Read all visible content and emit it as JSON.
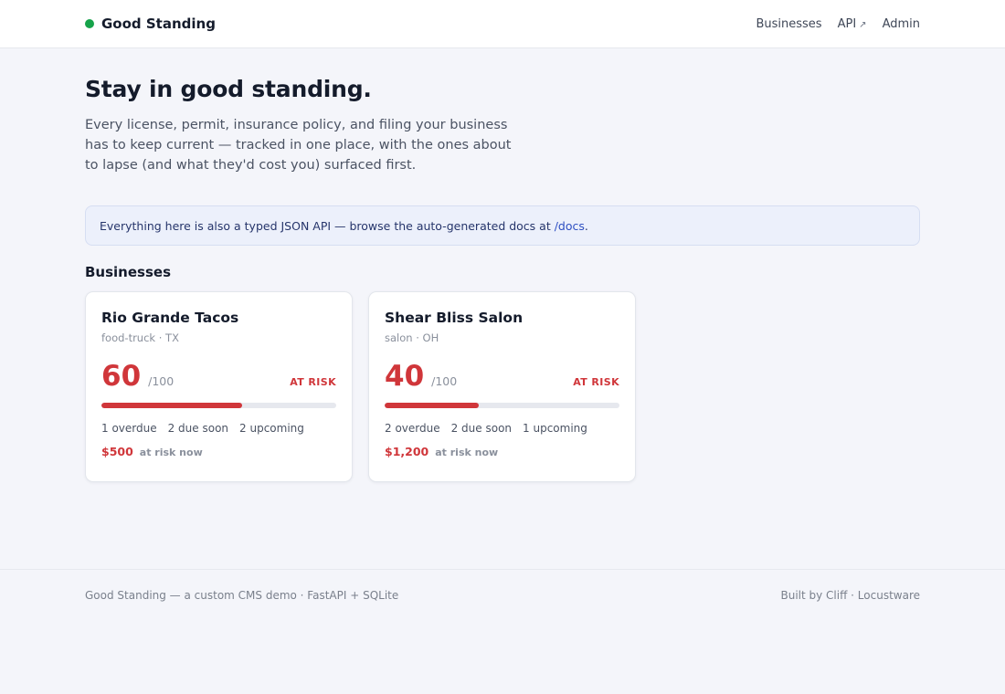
{
  "header": {
    "brand": "Good Standing",
    "nav": [
      {
        "label": "Businesses"
      },
      {
        "label": "API",
        "ext": "↗"
      },
      {
        "label": "Admin"
      }
    ]
  },
  "hero": {
    "title": "Stay in good standing.",
    "description": "Every license, permit, insurance policy, and filing your business has to keep current — tracked in one place, with the ones about to lapse (and what they'd cost you) surfaced first."
  },
  "banner": {
    "text": "Everything here is also a typed JSON API — browse the auto-generated docs at ",
    "link": "/docs",
    "end": "."
  },
  "businesses": {
    "title": "Businesses",
    "cards": [
      {
        "name": "Rio Grande Tacos",
        "meta": "food-truck · TX",
        "score": "60",
        "score_max": "/100",
        "status": "AT RISK",
        "progress": 0.6,
        "overdue": "1 overdue",
        "due_soon": "2 due soon",
        "upcoming": "2 upcoming",
        "risk_amount": "$500",
        "risk_label": "at risk now"
      },
      {
        "name": "Shear Bliss Salon",
        "meta": "salon · OH",
        "score": "40",
        "score_max": "/100",
        "status": "AT RISK",
        "progress": 0.4,
        "overdue": "2 overdue",
        "due_soon": "2 due soon",
        "upcoming": "1 upcoming",
        "risk_amount": "$1,200",
        "risk_label": "at risk now"
      }
    ]
  },
  "footer": {
    "left": "Good Standing — a custom CMS demo · FastAPI + SQLite",
    "right": "Built by Cliff · Locustware"
  },
  "colors": {
    "accent": "#d0363a",
    "brand_dot": "#16a34a",
    "link": "#2e4fc2"
  }
}
